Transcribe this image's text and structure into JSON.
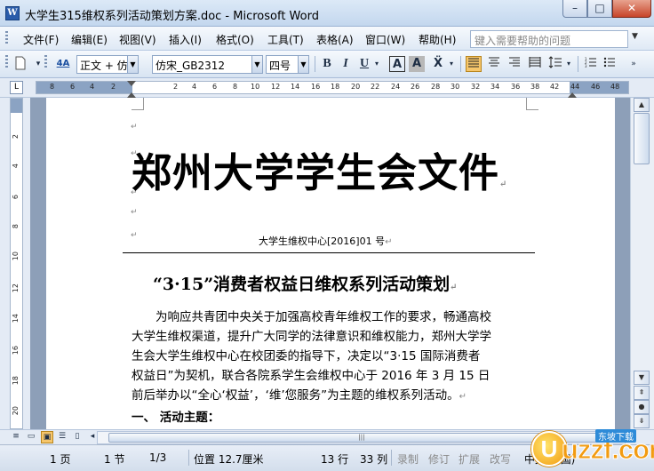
{
  "window": {
    "title": "大学生315维权系列活动策划方案.doc - Microsoft Word",
    "app_icon": "W",
    "buttons": {
      "minimize": "–",
      "maximize": "□",
      "close": "✕"
    }
  },
  "menu": {
    "items": [
      "文件(F)",
      "编辑(E)",
      "视图(V)",
      "插入(I)",
      "格式(O)",
      "工具(T)",
      "表格(A)",
      "窗口(W)",
      "帮助(H)"
    ],
    "help_placeholder": "键入需要帮助的问题"
  },
  "toolbar": {
    "style_value": "正文 + 仿宋",
    "font_value": "仿宋_GB2312",
    "size_value": "四号",
    "bold": "B",
    "italic": "I",
    "underline": "U",
    "char_border": "A",
    "char_shade": "A",
    "style_icon_label": "4A"
  },
  "ruler": {
    "corner": "L",
    "h_ticks": [
      "8",
      "6",
      "4",
      "2",
      "2",
      "4",
      "6",
      "8",
      "10",
      "12",
      "14",
      "16",
      "18",
      "20",
      "22",
      "24",
      "26",
      "28",
      "30",
      "32",
      "34",
      "36",
      "38",
      "42",
      "44",
      "46",
      "48"
    ],
    "v_ticks": [
      "2",
      "4",
      "6",
      "8",
      "10",
      "12",
      "14",
      "16",
      "18",
      "20"
    ]
  },
  "document": {
    "heading": "郑州大学学生会文件",
    "doc_number": "大学生维权中心[2016]01 号",
    "title": "“3·15”消费者权益日维权系列活动策划",
    "body_lines": [
      "为响应共青团中央关于加强高校青年维权工作的要求，畅通高校",
      "大学生维权渠道，提升广大同学的法律意识和维权能力，郑州大学学",
      "生会大学生维权中心在校团委的指导下，决定以“3·15 国际消费者",
      "权益日”为契机，联合各院系学生会维权中心于 2016 年 3 月 15 日",
      "前后举办以“全心‘权益’，‘维’您服务”为主题的维权系列活动。"
    ],
    "section1": "一、 活动主题：",
    "paragraph_mark": "↵"
  },
  "statusbar": {
    "page": "1 页",
    "section": "1 节",
    "page_of": "1/3",
    "position": "位置 12.7厘米",
    "line": "13 行",
    "column": "33 列",
    "rec": "录制",
    "trk": "修订",
    "ext": "扩展",
    "ovr": "改写",
    "language": "中文(中国)"
  },
  "watermark": {
    "logo_mark": "U",
    "logo_text": "uzzf.com",
    "tag": "东坡下载"
  },
  "colors": {
    "title_gradient_top": "#dce9f7",
    "doc_background": "#8d9fb8",
    "active_button": "#f6c66b"
  }
}
